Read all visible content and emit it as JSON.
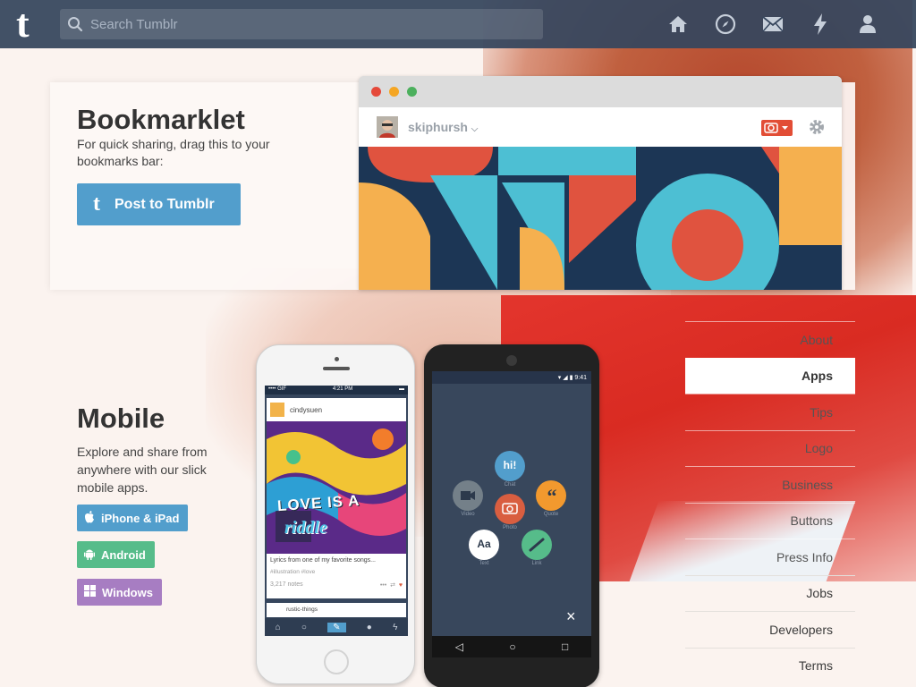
{
  "topbar": {
    "logo": "t",
    "search_placeholder": "Search Tumblr",
    "icons": [
      "home-icon",
      "explore-icon",
      "messages-icon",
      "activity-icon",
      "account-icon"
    ]
  },
  "bookmarklet": {
    "title": "Bookmarklet",
    "description": "For quick sharing, drag this to your bookmarks bar:",
    "button_label": "Post to Tumblr",
    "button_icon": "t"
  },
  "browser_mockup": {
    "username": "skiphursh",
    "camera_icon": "camera-icon",
    "gear_icon": "gear-icon"
  },
  "mobile": {
    "title": "Mobile",
    "description": "Explore and share from anywhere with our slick mobile apps.",
    "buttons": [
      {
        "label": "iPhone & iPad",
        "icon": "apple-icon",
        "color": "#529ecc"
      },
      {
        "label": "Android",
        "icon": "android-icon",
        "color": "#56bc8a"
      },
      {
        "label": "Windows",
        "icon": "windows-icon",
        "color": "#a77dc2"
      }
    ]
  },
  "iphone_mockup": {
    "status_time": "4:21 PM",
    "status_carrier": "•••• GIF",
    "post_user": "cindysuen",
    "art_text_1": "LOVE IS A",
    "art_text_2": "riddle",
    "caption": "Lyrics from one of my favorite songs...",
    "tags": "#illustration  #love",
    "notes": "3,217 notes",
    "next_user": "rustic-things"
  },
  "android_mockup": {
    "status_time": "9:41",
    "post_types": [
      {
        "label": "Chat",
        "text": "hi!",
        "color": "#529ecc"
      },
      {
        "label": "Video",
        "text": "",
        "color": "#748089"
      },
      {
        "label": "Quote",
        "text": "“",
        "color": "#f2992e"
      },
      {
        "label": "Photo",
        "text": "",
        "color": "#d95e40"
      },
      {
        "label": "Text",
        "text": "Aa",
        "color": "#ffffff"
      },
      {
        "label": "Link",
        "text": "",
        "color": "#56bc8a"
      }
    ],
    "close_label": "×"
  },
  "right_nav": {
    "items": [
      {
        "label": "About",
        "active": false
      },
      {
        "label": "Apps",
        "active": true
      },
      {
        "label": "Tips",
        "active": false
      },
      {
        "label": "Logo",
        "active": false
      },
      {
        "label": "Business",
        "active": false
      },
      {
        "label": "Buttons",
        "active": false
      },
      {
        "label": "Press Info",
        "active": false
      },
      {
        "label": "Jobs",
        "active": false
      },
      {
        "label": "Developers",
        "active": false
      },
      {
        "label": "Terms",
        "active": false
      }
    ]
  },
  "colors": {
    "topbar": "#36465d",
    "accent_blue": "#529ecc",
    "android_green": "#56bc8a",
    "windows_purple": "#a77dc2",
    "camera_red": "#e24d35"
  }
}
